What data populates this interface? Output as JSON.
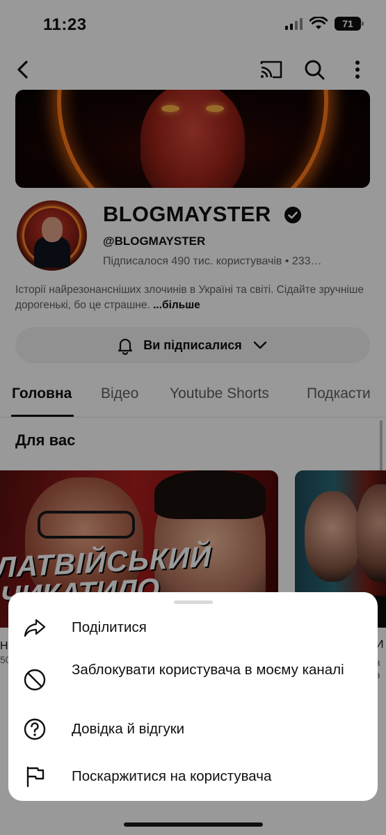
{
  "status_bar": {
    "time": "11:23",
    "battery": "71"
  },
  "banner": {},
  "channel": {
    "name": "BLOGMAYSTER",
    "handle": "@BLOGMAYSTER",
    "stats": "Підписалося 490 тис. користувачів  •  233…",
    "description": "Історії найрезонансніших злочинів в Україні та світі. Сідайте зручніше дорогенькі, бо це страшне.",
    "more_label": "...більше",
    "subscribed_label": "Ви підписалися"
  },
  "tabs": [
    {
      "label": "Головна",
      "active": true
    },
    {
      "label": "Відео",
      "active": false
    },
    {
      "label": "Youtube Shorts",
      "active": false
    },
    {
      "label": "Подкасти",
      "active": false
    }
  ],
  "section_title": "Для вас",
  "videos": [
    {
      "thumb_text_line1": "ЛАТВІЙСЬКИЙ",
      "thumb_text_line2": "ЧИКАТИЛО",
      "under_title_fragment": "НА",
      "under_meta_fragment": "50"
    },
    {
      "under_title_fragment": "И",
      "under_meta_fragment_1": "з",
      "under_meta_fragment_2": "з"
    }
  ],
  "sheet": {
    "items": [
      {
        "label": "Поділитися",
        "icon": "share-icon"
      },
      {
        "label": "Заблокувати користувача в моєму каналі",
        "icon": "block-icon"
      },
      {
        "label": "Довідка й відгуки",
        "icon": "help-icon"
      },
      {
        "label": "Поскаржитися на користувача",
        "icon": "flag-icon"
      }
    ]
  }
}
